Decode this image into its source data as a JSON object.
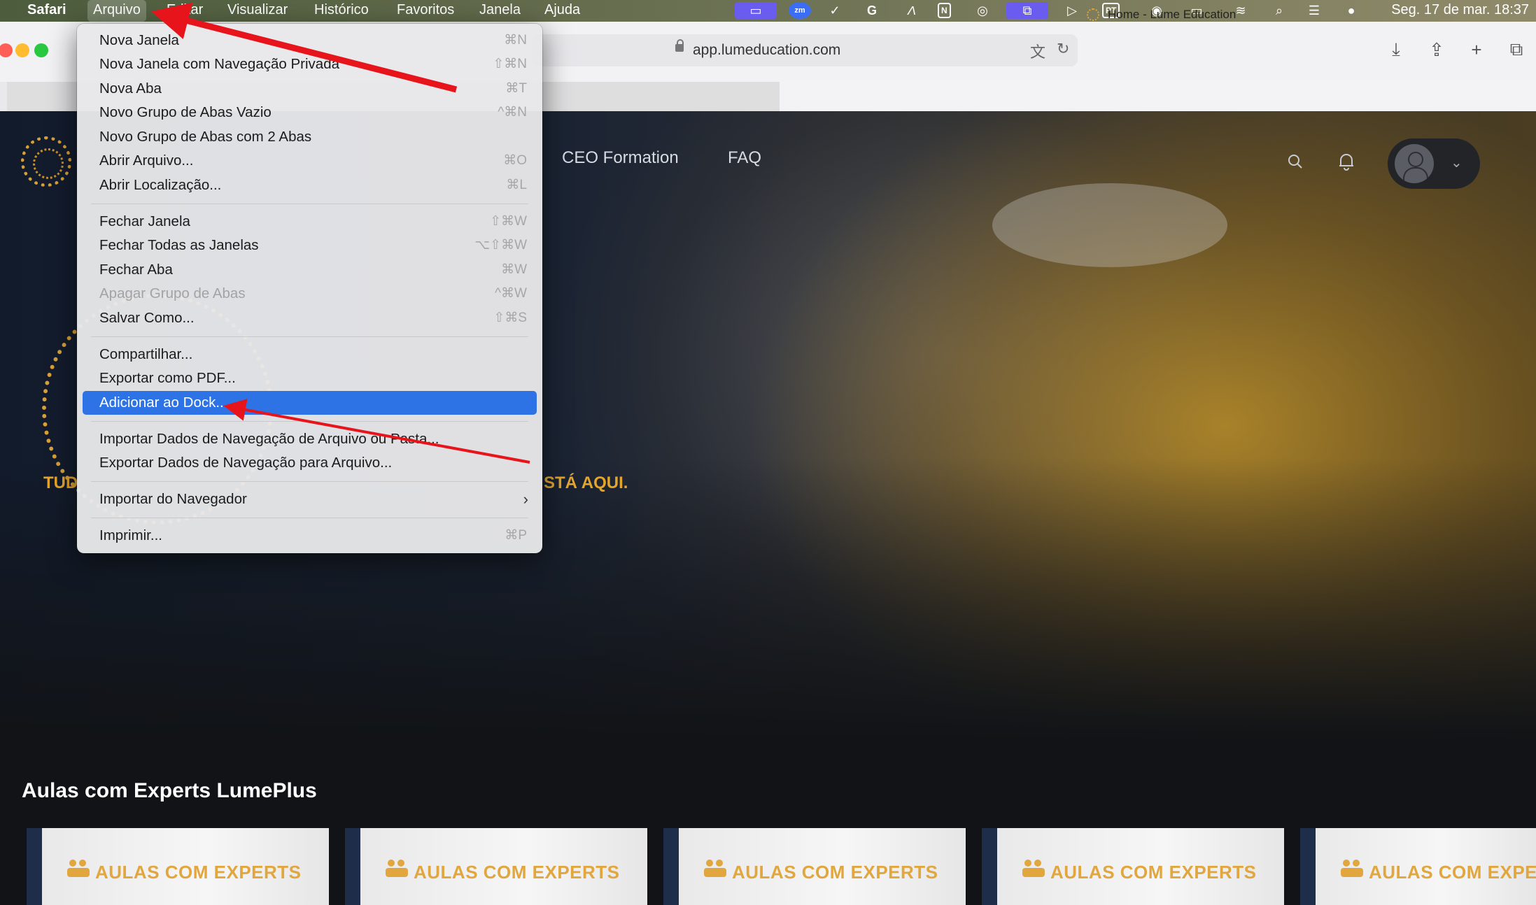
{
  "menubar": {
    "apple": "",
    "items": [
      "Safari",
      "Arquivo",
      "Editar",
      "Visualizar",
      "Histórico",
      "Favoritos",
      "Janela",
      "Ajuda"
    ],
    "status_icons": [
      "screen-share-icon",
      "zoom-icon",
      "checkmark-circle-icon",
      "grammarly-icon",
      "script-icon",
      "notion-icon",
      "airdrop-icon",
      "window-icon",
      "play-icon",
      "input-source-icon",
      "user-icon",
      "battery-icon",
      "wifi-icon",
      "spotlight-icon",
      "control-center-icon",
      "siri-icon"
    ],
    "zoom_label": "zm",
    "notion_label": "N",
    "input_label": "PT",
    "clock": "Seg. 17 de mar.  18:37"
  },
  "browser": {
    "url": "app.lumeducation.com",
    "tab_title": "Home - Lume Education"
  },
  "file_menu": {
    "items": [
      {
        "label": "Nova Janela",
        "shortcut": "⌘N"
      },
      {
        "label": "Nova Janela com Navegação Privada",
        "shortcut": "⇧⌘N"
      },
      {
        "label": "Nova Aba",
        "shortcut": "⌘T"
      },
      {
        "label": "Novo Grupo de Abas Vazio",
        "shortcut": "^⌘N"
      },
      {
        "label": "Novo Grupo de Abas com 2 Abas",
        "shortcut": ""
      },
      {
        "label": "Abrir Arquivo...",
        "shortcut": "⌘O"
      },
      {
        "label": "Abrir Localização...",
        "shortcut": "⌘L"
      },
      {
        "label": "Fechar Janela",
        "shortcut": "⇧⌘W"
      },
      {
        "label": "Fechar Todas as Janelas",
        "shortcut": "⌥⇧⌘W"
      },
      {
        "label": "Fechar Aba",
        "shortcut": "⌘W"
      },
      {
        "label": "Apagar Grupo de Abas",
        "shortcut": "^⌘W"
      },
      {
        "label": "Salvar Como...",
        "shortcut": "⇧⌘S"
      },
      {
        "label": "Compartilhar...",
        "shortcut": ""
      },
      {
        "label": "Exportar como PDF...",
        "shortcut": ""
      },
      {
        "label": "Adicionar ao Dock...",
        "shortcut": ""
      },
      {
        "label": "Importar Dados de Navegação de Arquivo ou Pasta...",
        "shortcut": ""
      },
      {
        "label": "Exportar Dados de Navegação para Arquivo...",
        "shortcut": ""
      },
      {
        "label": "Importar do Navegador",
        "shortcut": ""
      },
      {
        "label": "Imprimir...",
        "shortcut": "⌘P"
      }
    ],
    "selected_label": "Adicionar ao Dock...",
    "disabled_label": "Apagar Grupo de Abas"
  },
  "site": {
    "nav": [
      "CEO Formation",
      "FAQ"
    ],
    "tagline_left": "TUD",
    "tagline_right": "STÁ AQUI.",
    "section_title": "Aulas com Experts LumePlus",
    "card_label": "AULAS COM EXPERTS",
    "card_label_cut": "AULAS COM EXPE"
  },
  "colors": {
    "accent_gold": "#e4a52d",
    "menu_highlight": "#2e73e6",
    "annotation_red": "#e8141b"
  }
}
